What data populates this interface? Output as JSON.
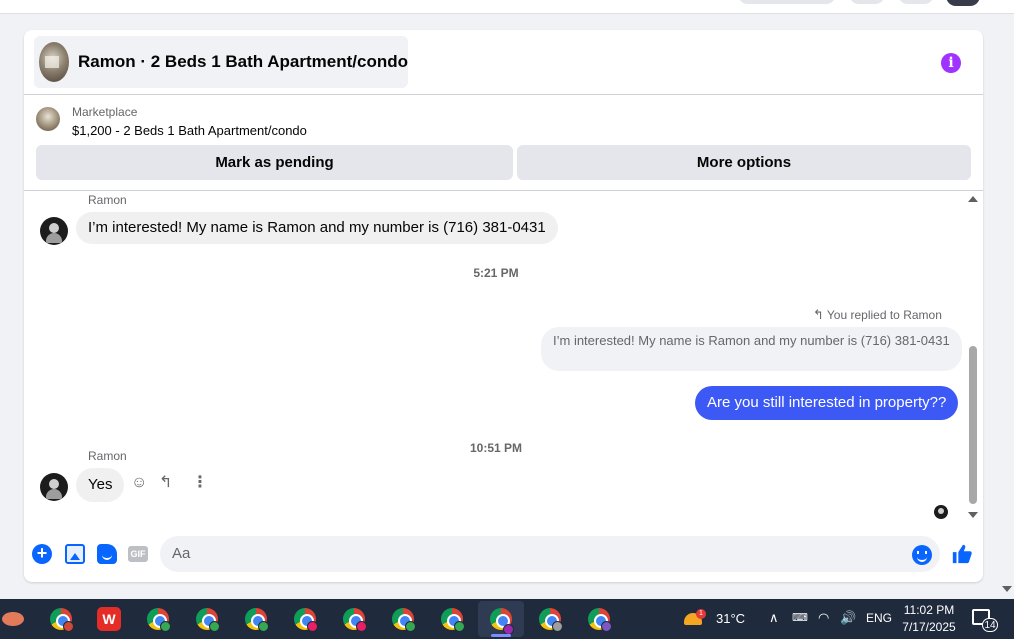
{
  "conversation": {
    "title": "Ramon · 2 Beds 1 Bath Apartment/condo"
  },
  "listing": {
    "source": "Marketplace",
    "price_title": "$1,200 - 2 Beds 1 Bath Apartment/condo",
    "pending_button": "Mark as pending",
    "more_button": "More options"
  },
  "messages": {
    "sender1": "Ramon",
    "msg1": "I’m interested! My name is Ramon and my number is (716) 381-0431",
    "time1": "5:21 PM",
    "replied_label": "You replied to Ramon",
    "quoted": "I’m interested! My name is Ramon and my number is (716) 381-0431",
    "outgoing": "Are you still interested in property??",
    "time2": "10:51 PM",
    "sender2": "Ramon",
    "msg2": "Yes"
  },
  "composer": {
    "placeholder": "Aa",
    "gif_label": "GIF"
  },
  "taskbar": {
    "weather_badge": "1",
    "temperature": "31°C",
    "language": "ENG",
    "time": "11:02 PM",
    "date": "7/17/2025",
    "notifications": "14",
    "wps_label": "W",
    "apps": [
      {
        "name": "chrome-T",
        "badge_color": "#d14836"
      },
      {
        "name": "wps"
      },
      {
        "name": "chrome-green-1",
        "badge_color": "#34a853"
      },
      {
        "name": "chrome-green-2",
        "badge_color": "#34a853"
      },
      {
        "name": "chrome-green-3",
        "badge_color": "#34a853"
      },
      {
        "name": "chrome-pink-1",
        "badge_color": "#e91e63"
      },
      {
        "name": "chrome-pink-2",
        "badge_color": "#e91e63"
      },
      {
        "name": "chrome-green-4",
        "badge_color": "#34a853"
      },
      {
        "name": "chrome-green-5",
        "badge_color": "#34a853"
      },
      {
        "name": "chrome-purple-active",
        "badge_color": "#9c27b0"
      },
      {
        "name": "chrome-gray",
        "badge_color": "#9e9e9e"
      },
      {
        "name": "chrome-purple",
        "badge_color": "#7e57c2"
      }
    ]
  },
  "colors": {
    "accent": "#0866ff",
    "outgoing_bubble": "#3d59f5",
    "info_icon": "#a033ff",
    "taskbar": "#1f2a3d"
  }
}
